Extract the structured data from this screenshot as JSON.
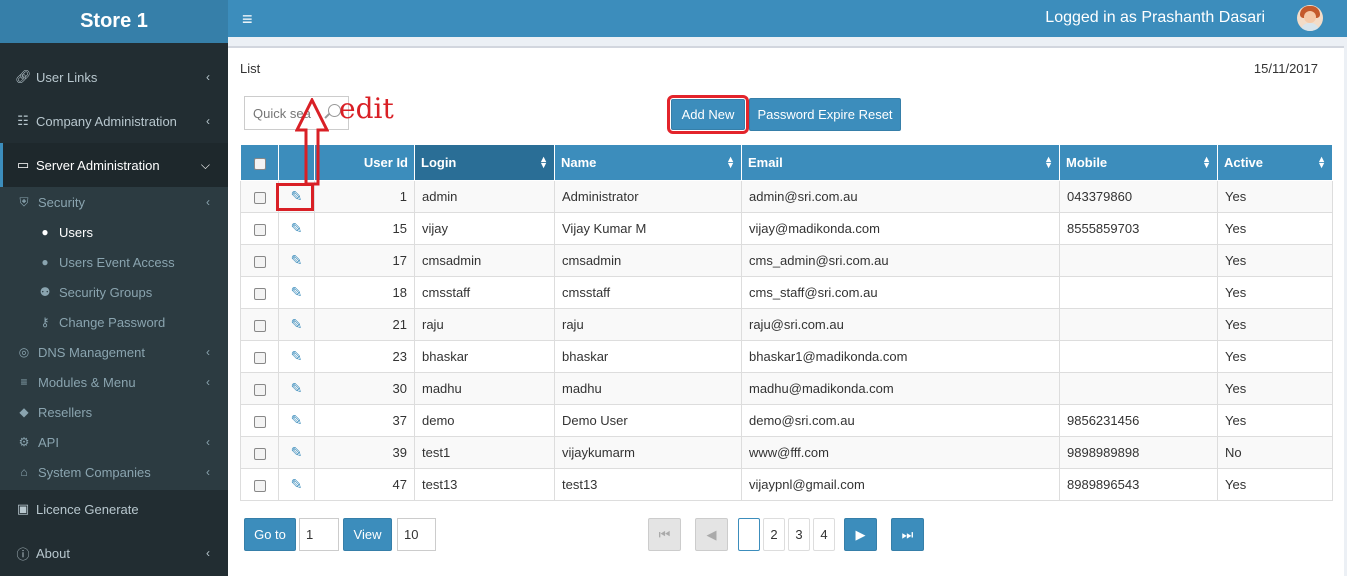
{
  "brand": "Store 1",
  "header": {
    "logged_in": "Logged in as Prashanth Dasari"
  },
  "sidebar": {
    "items": [
      {
        "label": "User Links",
        "icon": "link-icon"
      },
      {
        "label": "Company Administration",
        "icon": "sitemap-icon"
      },
      {
        "label": "Server Administration",
        "icon": "desktop-icon"
      },
      {
        "label": "Licence Generate",
        "icon": "lock-icon"
      },
      {
        "label": "About",
        "icon": "info-icon"
      }
    ],
    "sub": [
      {
        "label": "Security",
        "icon": "shield-icon"
      },
      {
        "label": "Users",
        "icon": "user-icon"
      },
      {
        "label": "Users Event Access",
        "icon": "user-icon"
      },
      {
        "label": "Security Groups",
        "icon": "users-icon"
      },
      {
        "label": "Change Password",
        "icon": "key-icon"
      },
      {
        "label": "DNS Management",
        "icon": "globe-icon"
      },
      {
        "label": "Modules & Menu",
        "icon": "bars-icon"
      },
      {
        "label": "Resellers",
        "icon": "tag-icon"
      },
      {
        "label": "API",
        "icon": "gear-icon"
      },
      {
        "label": "System Companies",
        "icon": "bank-icon"
      }
    ]
  },
  "page": {
    "title": "List",
    "date": "15/11/2017",
    "search_placeholder": "Quick sea",
    "add_new": "Add New",
    "password_reset": "Password Expire Reset",
    "annotation": "edit"
  },
  "table": {
    "headers": [
      "User Id",
      "Login",
      "Name",
      "Email",
      "Mobile",
      "Active"
    ],
    "rows": [
      [
        "1",
        "admin",
        "Administrator",
        "admin@sri.com.au",
        "043379860",
        "Yes"
      ],
      [
        "15",
        "vijay",
        "Vijay Kumar M",
        "vijay@madikonda.com",
        "8555859703",
        "Yes"
      ],
      [
        "17",
        "cmsadmin",
        "cmsadmin",
        "cms_admin@sri.com.au",
        "",
        "Yes"
      ],
      [
        "18",
        "cmsstaff",
        "cmsstaff",
        "cms_staff@sri.com.au",
        "",
        "Yes"
      ],
      [
        "21",
        "raju",
        "raju",
        "raju@sri.com.au",
        "",
        "Yes"
      ],
      [
        "23",
        "bhaskar",
        "bhaskar",
        "bhaskar1@madikonda.com",
        "",
        "Yes"
      ],
      [
        "30",
        "madhu",
        "madhu",
        "madhu@madikonda.com",
        "",
        "Yes"
      ],
      [
        "37",
        "demo",
        "Demo User",
        "demo@sri.com.au",
        "9856231456",
        "Yes"
      ],
      [
        "39",
        "test1",
        "vijaykumarm",
        "www@fff.com",
        "9898989898",
        "No"
      ],
      [
        "47",
        "test13",
        "test13",
        "vijaypnl@gmail.com",
        "8989896543",
        "Yes"
      ]
    ]
  },
  "pager": {
    "goto_label": "Go to",
    "goto_value": "1",
    "view_label": "View",
    "view_value": "10",
    "current_page": "",
    "pages": [
      "2",
      "3",
      "4"
    ]
  }
}
